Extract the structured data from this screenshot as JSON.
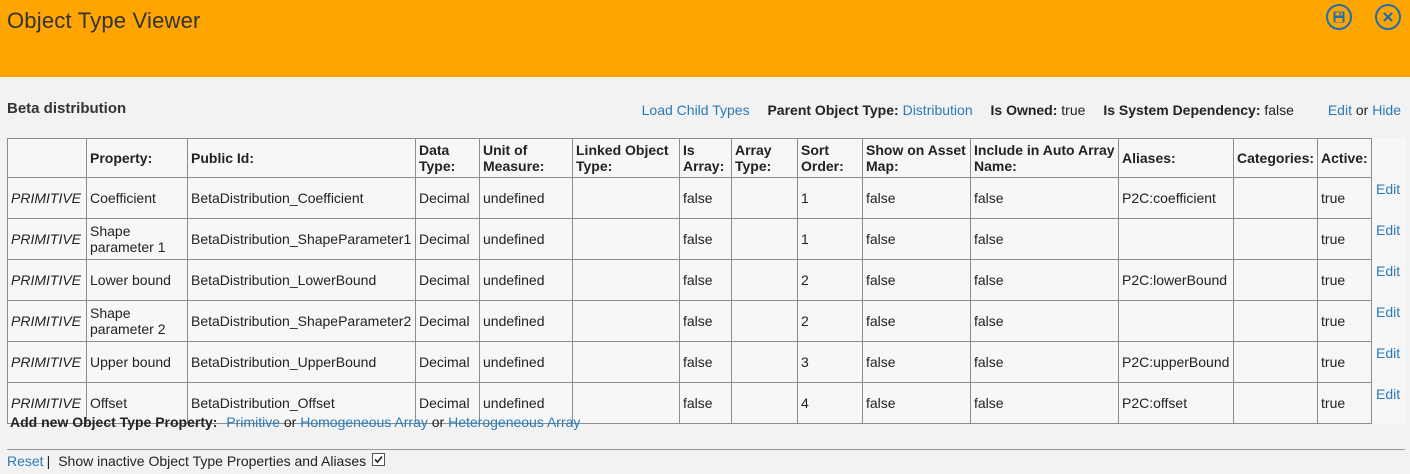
{
  "app": {
    "title": "Object Type Viewer"
  },
  "header": {
    "object_name": "Beta distribution",
    "load_child_types": "Load Child Types",
    "parent_label": "Parent Object Type:",
    "parent_value": "Distribution",
    "owned_label": "Is Owned:",
    "owned_value": "true",
    "sysdep_label": "Is System Dependency:",
    "sysdep_value": "false",
    "edit_link": "Edit",
    "or_text": "or",
    "hide_link": "Hide"
  },
  "table": {
    "columns": [
      "",
      "Property:",
      "Public Id:",
      "Data Type:",
      "Unit of Measure:",
      "Linked Object Type:",
      "Is Array:",
      "Array Type:",
      "Sort Order:",
      "Show on Asset Map:",
      "Include in Auto Array Name:",
      "Aliases:",
      "Categories:",
      "Active:"
    ],
    "rows": [
      [
        "PRIMITIVE",
        "Coefficient",
        "BetaDistribution_Coefficient",
        "Decimal",
        "undefined",
        "",
        "false",
        "",
        "1",
        "false",
        "false",
        "P2C:coefficient",
        "",
        "true"
      ],
      [
        "PRIMITIVE",
        "Shape parameter 1",
        "BetaDistribution_ShapeParameter1",
        "Decimal",
        "undefined",
        "",
        "false",
        "",
        "1",
        "false",
        "false",
        "",
        "",
        "true"
      ],
      [
        "PRIMITIVE",
        "Lower bound",
        "BetaDistribution_LowerBound",
        "Decimal",
        "undefined",
        "",
        "false",
        "",
        "2",
        "false",
        "false",
        "P2C:lowerBound",
        "",
        "true"
      ],
      [
        "PRIMITIVE",
        "Shape parameter 2",
        "BetaDistribution_ShapeParameter2",
        "Decimal",
        "undefined",
        "",
        "false",
        "",
        "2",
        "false",
        "false",
        "",
        "",
        "true"
      ],
      [
        "PRIMITIVE",
        "Upper bound",
        "BetaDistribution_UpperBound",
        "Decimal",
        "undefined",
        "",
        "false",
        "",
        "3",
        "false",
        "false",
        "P2C:upperBound",
        "",
        "true"
      ],
      [
        "PRIMITIVE",
        "Offset",
        "BetaDistribution_Offset",
        "Decimal",
        "undefined",
        "",
        "false",
        "",
        "4",
        "false",
        "false",
        "P2C:offset",
        "",
        "true"
      ]
    ],
    "row_action": "Edit"
  },
  "add_property": {
    "label": "Add new Object Type Property:",
    "primitive": "Primitive",
    "or1": "or",
    "homogeneous": "Homogeneous Array",
    "or2": "or",
    "heterogeneous": "Heterogeneous Array"
  },
  "footer": {
    "reset": "Reset",
    "separator": "|",
    "show_inactive": "Show inactive Object Type Properties and Aliases",
    "show_inactive_checked": true
  },
  "icons": {
    "save": "floppy-disk-icon",
    "close": "close-icon"
  },
  "colors": {
    "titlebar": "#ffa500",
    "link": "#2a7ab8",
    "icon": "#1f6fae"
  }
}
